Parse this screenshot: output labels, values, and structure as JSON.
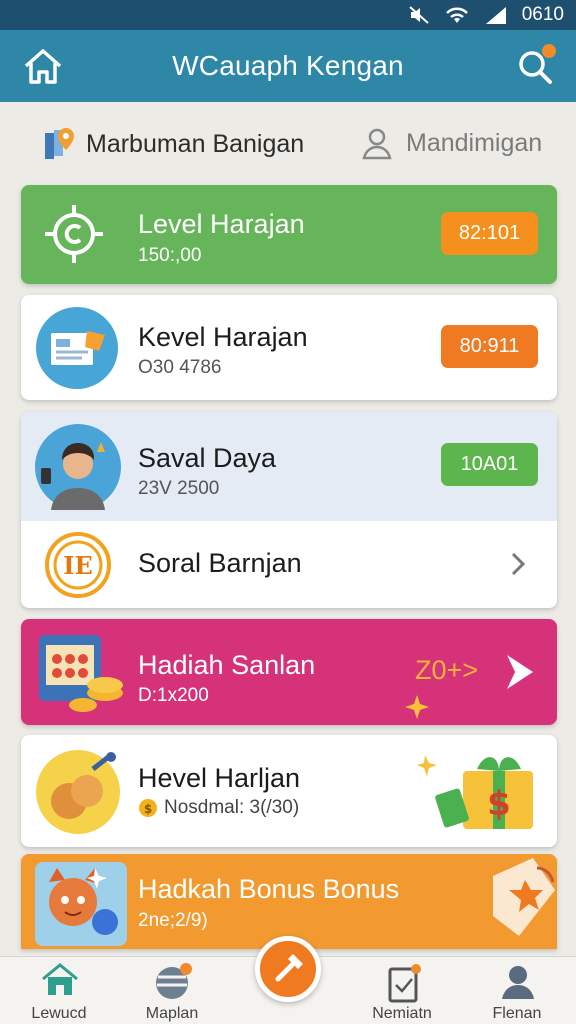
{
  "status_bar": {
    "time": "0610",
    "icons": [
      "mute-icon",
      "wifi-icon",
      "signal-icon"
    ]
  },
  "app_bar": {
    "title": "WCauaph Kengan",
    "left_icon": "home-icon",
    "right_icon": "search-icon"
  },
  "subheader": {
    "left_label": "Marbuman Banigan",
    "left_icon": "map-pin-icon",
    "right_label": "Mandimigan",
    "right_icon": "user-icon"
  },
  "cards": [
    {
      "title": "Level Harajan",
      "subtitle": "150:,00",
      "badge": "82:101",
      "icon": "target-icon",
      "color": "#66b55a",
      "badge_color": "#f5901f"
    },
    {
      "title": "Kevel Harajan",
      "subtitle": "O30 4786",
      "badge": "80:911",
      "icon": "document-icon",
      "badge_color": "#f07a22"
    },
    {
      "title": "Saval Daya",
      "subtitle": "23V 2500",
      "badge": "10A01",
      "icon": "avatar-icon",
      "badge_color": "#5db54e"
    },
    {
      "title": "Soral Barnjan",
      "icon": "coin-icon",
      "action_icon": "chevron-right-icon"
    },
    {
      "title": "Hadiah Sanlan",
      "subtitle": "D:1x200",
      "badge": "Z0+>",
      "icon": "slot-machine-icon",
      "color": "#d6327a"
    },
    {
      "title": "Hevel Harljan",
      "subtitle": "Nosdmal: 3(/30)",
      "icon": "cookie-icon",
      "side_icon": "gift-icon"
    },
    {
      "title": "Hadkah Bonus Bonus",
      "subtitle": "2ne;2/9)",
      "icon": "character-icon",
      "color": "#f29a30"
    }
  ],
  "nav": [
    {
      "label": "Lewucd",
      "icon": "home-icon",
      "active": true
    },
    {
      "label": "Maplan",
      "icon": "stack-icon"
    },
    {
      "label": "",
      "icon": "hammer-icon"
    },
    {
      "label": "Nemiatn",
      "icon": "clipboard-icon"
    },
    {
      "label": "Flenan",
      "icon": "profile-icon"
    }
  ]
}
